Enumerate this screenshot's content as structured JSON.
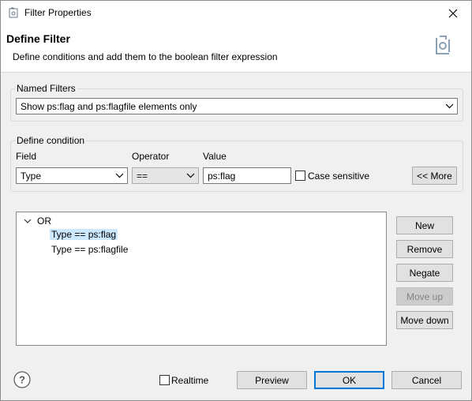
{
  "window": {
    "title": "Filter Properties"
  },
  "header": {
    "title": "Define Filter",
    "description": "Define conditions and add them to the boolean filter expression"
  },
  "named_filters": {
    "label": "Named Filters",
    "selected": "Show ps:flag and ps:flagfile elements only"
  },
  "define_condition": {
    "label": "Define condition",
    "field_label": "Field",
    "operator_label": "Operator",
    "value_label": "Value",
    "field_value": "Type",
    "operator_value": "==",
    "value_input": "ps:flag",
    "case_sensitive_label": "Case sensitive",
    "case_sensitive_checked": false,
    "more_button": "<< More"
  },
  "tree": {
    "root": "OR",
    "children": [
      {
        "label": "Type == ps:flag",
        "selected": true
      },
      {
        "label": "Type == ps:flagfile",
        "selected": false
      }
    ]
  },
  "side_buttons": {
    "new": "New",
    "remove": "Remove",
    "negate": "Negate",
    "move_up": "Move up",
    "move_down": "Move down"
  },
  "footer": {
    "realtime_label": "Realtime",
    "realtime_checked": false,
    "preview": "Preview",
    "ok": "OK",
    "cancel": "Cancel"
  },
  "icons": {
    "title": "filter-icon",
    "header": "filter-refresh-icon",
    "close": "close-icon",
    "help": "help-icon"
  }
}
